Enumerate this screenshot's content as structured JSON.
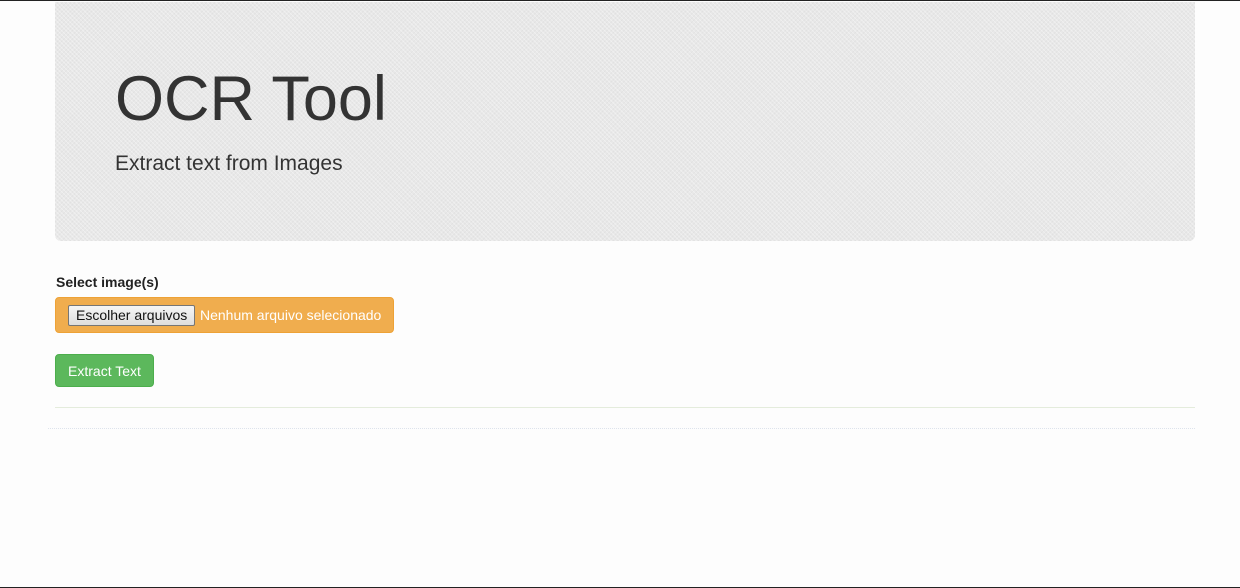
{
  "header": {
    "title": "OCR Tool",
    "subtitle": "Extract text from Images"
  },
  "form": {
    "label": "Select image(s)",
    "file_button_label": "Escolher arquivos",
    "file_status": "Nenhum arquivo selecionado",
    "submit_label": "Extract Text"
  },
  "colors": {
    "file_input_bg": "#f0ad4e",
    "submit_bg": "#5cb85c",
    "header_bg": "#e8e8e8"
  }
}
